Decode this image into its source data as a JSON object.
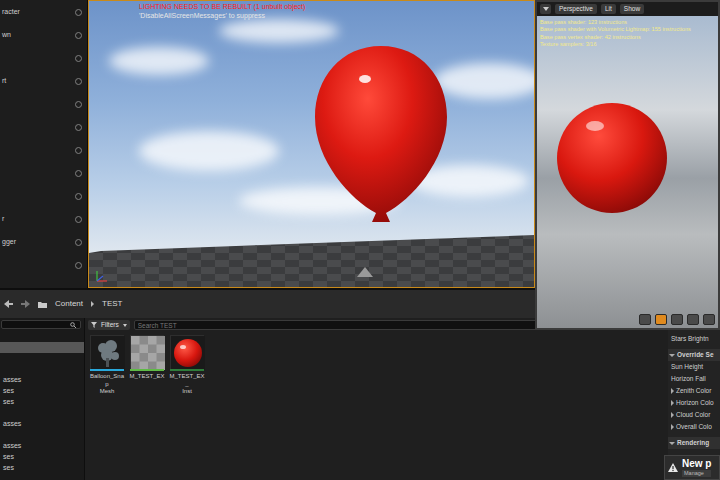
{
  "outliner": {
    "items": [
      {
        "label": "racter"
      },
      {
        "label": "wn"
      },
      {
        "label": ""
      },
      {
        "label": "rt"
      },
      {
        "label": ""
      },
      {
        "label": ""
      },
      {
        "label": ""
      },
      {
        "label": ""
      },
      {
        "label": ""
      },
      {
        "label": "r"
      },
      {
        "label": "gger"
      },
      {
        "label": ""
      }
    ]
  },
  "viewport": {
    "messages": [
      {
        "text": "LIGHTING NEEDS TO BE REBUILT (1 unbuilt object)",
        "color": "#ff2020"
      },
      {
        "text": "'DisableAllScreenMessages' to suppress",
        "color": "#e6e6e6"
      }
    ]
  },
  "preview": {
    "toolbar": [
      {
        "label": "Perspective"
      },
      {
        "label": "Lit"
      },
      {
        "label": "Show"
      }
    ],
    "stats": [
      "Base pass shader: 123 instructions",
      "Base pass shader with Volumetric Lightmap: 155 instructions",
      "Base pass vertex shader: 42 instructions",
      "Texture samplers: 3/16"
    ],
    "view_buttons": [
      {
        "selected": false
      },
      {
        "selected": true
      },
      {
        "selected": false
      },
      {
        "selected": false
      },
      {
        "selected": false
      }
    ]
  },
  "content_browser": {
    "path": [
      "Content",
      "TEST"
    ],
    "sources": [
      {
        "label": "",
        "selected": false
      },
      {
        "label": "",
        "selected": true
      },
      {
        "label": "",
        "selected": false
      },
      {
        "label": "",
        "selected": false
      },
      {
        "label": "asses",
        "selected": false
      },
      {
        "label": "ses",
        "selected": false
      },
      {
        "label": "ses",
        "selected": false
      },
      {
        "label": "",
        "selected": false
      },
      {
        "label": "asses",
        "selected": false
      },
      {
        "label": "",
        "selected": false
      },
      {
        "label": "asses",
        "selected": false
      },
      {
        "label": "ses",
        "selected": false
      },
      {
        "label": "ses",
        "selected": false
      }
    ],
    "filters": "Filters",
    "search": {
      "placeholder": "Search TEST"
    },
    "assets": [
      {
        "lines": [
          "Balloon_Snap",
          "Mesh"
        ],
        "kind": "mesh",
        "color": "#29a9dc"
      },
      {
        "lines": [
          "M_TEST_EX"
        ],
        "kind": "material",
        "color": "#5fbb46"
      },
      {
        "lines": [
          "M_TEST_EX_",
          "Inst"
        ],
        "kind": "instance",
        "color": "#2e7d3a"
      }
    ]
  },
  "details": {
    "items": [
      {
        "label": "Stars Brightn",
        "kind": "property"
      },
      {
        "label": "Override Se",
        "kind": "section",
        "expanded": true
      },
      {
        "label": "Sun Height",
        "kind": "property"
      },
      {
        "label": "Horizon Fall",
        "kind": "property"
      },
      {
        "label": "Zenith Color",
        "kind": "struct",
        "expanded": false
      },
      {
        "label": "Horizon Colo",
        "kind": "struct",
        "expanded": false
      },
      {
        "label": "Cloud Color",
        "kind": "struct",
        "expanded": false
      },
      {
        "label": "Overall Colo",
        "kind": "struct",
        "expanded": false
      },
      {
        "label": "Rendering",
        "kind": "section",
        "expanded": true
      }
    ]
  },
  "notification": {
    "title": "New p",
    "action": "Manage"
  }
}
